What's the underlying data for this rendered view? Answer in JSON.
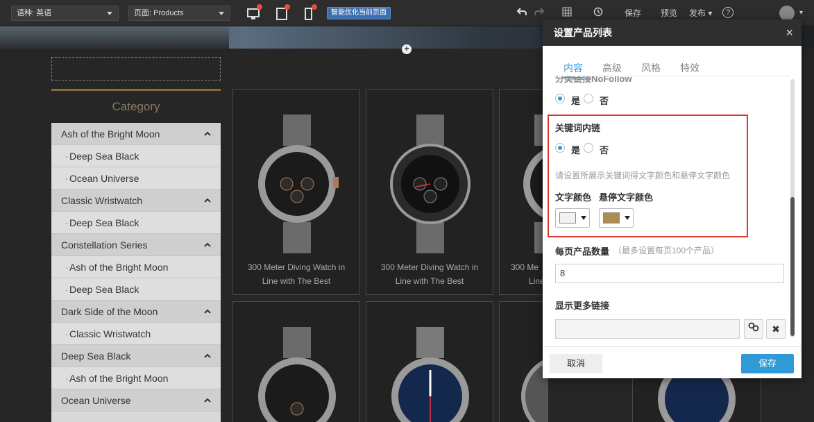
{
  "toolbar": {
    "language": "语种: 英语",
    "page": "页面: Products",
    "smart_optimize": "智能优化当前页面",
    "save": "保存",
    "preview": "预览",
    "publish": "发布",
    "help": "?"
  },
  "sidebar": {
    "title": "Category",
    "items": [
      {
        "label": "Ash of the Bright Moon",
        "level": "parent"
      },
      {
        "label": "Deep Sea Black",
        "level": "child"
      },
      {
        "label": "Ocean Universe",
        "level": "child"
      },
      {
        "label": "Classic Wristwatch",
        "level": "parent"
      },
      {
        "label": "Deep Sea Black",
        "level": "child"
      },
      {
        "label": "Constellation Series",
        "level": "parent"
      },
      {
        "label": "Ash of the Bright Moon",
        "level": "child"
      },
      {
        "label": "Deep Sea Black",
        "level": "child"
      },
      {
        "label": "Dark Side of the Moon",
        "level": "parent"
      },
      {
        "label": "Classic Wristwatch",
        "level": "child"
      },
      {
        "label": "Deep Sea Black",
        "level": "parent"
      },
      {
        "label": "Ash of the Bright Moon",
        "level": "child"
      },
      {
        "label": "Ocean Universe",
        "level": "parent"
      }
    ]
  },
  "products": {
    "name_line1": "300 Meter Diving Watch in",
    "name_line2": "Line with The Best",
    "name_line1_partial": "300 Me",
    "name_line2_partial": "Line"
  },
  "dialog": {
    "title": "设置产品列表",
    "close": "×",
    "tabs": [
      "内容",
      "高级",
      "风格",
      "特效"
    ],
    "nofollow_label": "分类链接NoFollow",
    "yes": "是",
    "no": "否",
    "keyword_link_label": "关键词内链",
    "keyword_hint": "请设置所展示关键词得文字颜色和悬停文字颜色",
    "text_color_label": "文字颜色",
    "hover_color_label": "悬停文字颜色",
    "text_color": "#f2f2f2",
    "hover_color": "#b08a55",
    "per_page_label": "每页产品数量",
    "per_page_hint": "（最多设置每页100个产品）",
    "per_page_value": "8",
    "more_link_label": "显示更多链接",
    "more_link_value": "",
    "cancel": "取消",
    "save": "保存"
  }
}
